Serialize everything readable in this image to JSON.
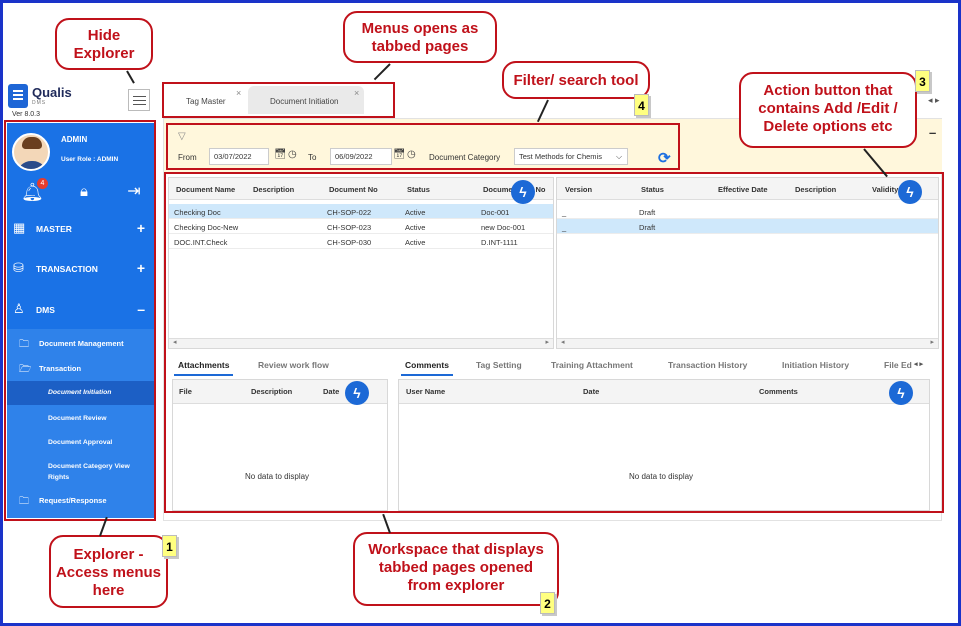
{
  "app": {
    "name": "Qualis",
    "sub": "DMS",
    "version": "Ver 8.0.3"
  },
  "user": {
    "name": "ADMIN",
    "role": "User Role : ADMIN",
    "notifications": "4"
  },
  "sidebar": {
    "menus": [
      {
        "label": "MASTER",
        "sign": "+"
      },
      {
        "label": "TRANSACTION",
        "sign": "+"
      },
      {
        "label": "DMS",
        "sign": "–"
      }
    ],
    "dms_items": [
      {
        "label": "Document Management"
      },
      {
        "label": "Transaction"
      },
      {
        "label": "Document Initiation"
      },
      {
        "label": "Document Review"
      },
      {
        "label": "Document Approval"
      },
      {
        "label": "Document Category View Rights"
      },
      {
        "label": "Request/Response"
      }
    ]
  },
  "tabs": [
    {
      "label": "Tag Master",
      "close": "×"
    },
    {
      "label": "Document Initiation",
      "close": "×"
    }
  ],
  "filter": {
    "from_label": "From",
    "from_value": "03/07/2022",
    "to_label": "To",
    "to_value": "06/09/2022",
    "category_label": "Document Category",
    "category_value": "Test Methods for Chemis"
  },
  "left_grid": {
    "headers": [
      "Document Name",
      "Description",
      "Document No",
      "Status",
      "Document Ver No"
    ],
    "rows": [
      [
        "Checking Doc",
        "",
        "CH-SOP-022",
        "Active",
        "Doc-001"
      ],
      [
        "Checking Doc-New",
        "",
        "CH-SOP-023",
        "Active",
        "new Doc-001"
      ],
      [
        "DOC.INT.Check",
        "",
        "CH-SOP-030",
        "Active",
        "D.INT-1111"
      ]
    ]
  },
  "right_grid": {
    "headers": [
      "Version",
      "Status",
      "Effective Date",
      "Description",
      "Validity"
    ],
    "rows": [
      [
        "_",
        "Draft",
        "",
        "",
        ""
      ],
      [
        "_",
        "Draft",
        "",
        "",
        ""
      ]
    ]
  },
  "bottom_left": {
    "tabs": [
      "Attachments",
      "Review work flow"
    ],
    "headers": [
      "File",
      "Description",
      "Date"
    ],
    "empty": "No data to display"
  },
  "bottom_right": {
    "tabs": [
      "Comments",
      "Tag Setting",
      "Training Attachment",
      "Transaction History",
      "Initiation History",
      "File Ed"
    ],
    "headers": [
      "User Name",
      "Date",
      "Comments"
    ],
    "empty": "No data to display"
  },
  "annotations": {
    "hide_explorer": "Hide Explorer",
    "menus_tabbed": "Menus opens as tabbed pages",
    "filter_tool": "Filter/ search tool",
    "action_button": "Action button that contains Add /Edit / Delete options etc",
    "explorer": "Explorer - Access menus here",
    "workspace": "Workspace that displays tabbed pages opened from explorer",
    "n1": "1",
    "n2": "2",
    "n3": "3",
    "n4": "4"
  },
  "colors": {
    "sidebar": "#1a72e6",
    "annotation": "#c0111a",
    "frame": "#1a33c9",
    "action": "#1c69d6"
  }
}
